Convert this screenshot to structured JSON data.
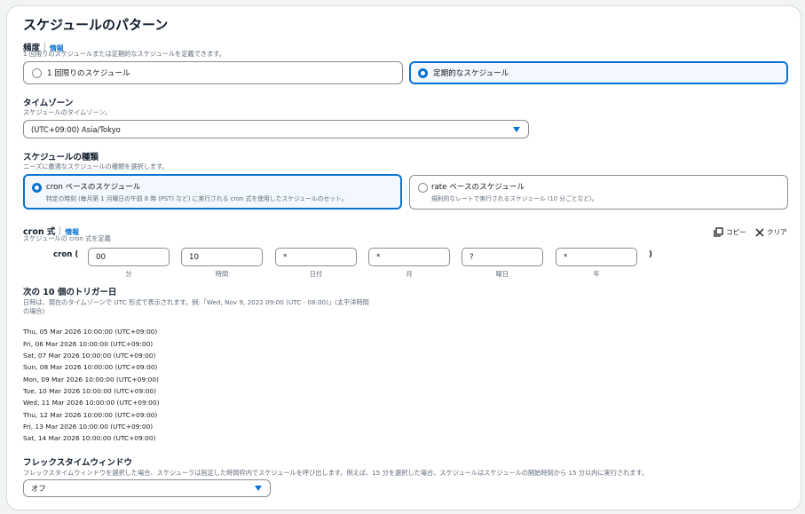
{
  "section": {
    "title": "スケジュールのパターン"
  },
  "frequency": {
    "label": "頻度",
    "info": "情報",
    "description": "1 回限りのスケジュールまたは定期的なスケジュールを定義できます。",
    "options": [
      {
        "label": "1 回限りのスケジュール",
        "selected": false
      },
      {
        "label": "定期的なスケジュール",
        "selected": true
      }
    ]
  },
  "timezone": {
    "label": "タイムゾーン",
    "description": "スケジュールのタイムゾーン。",
    "value": "(UTC+09:00) Asia/Tokyo"
  },
  "schedule_type": {
    "label": "スケジュールの種類",
    "description": "ニーズに最適なスケジュールの種類を選択します。",
    "options": [
      {
        "label": "cron ベースのスケジュール",
        "description": "特定の時刻 (毎月第 1 月曜日の午前 8 時 (PST) など) に実行される cron 式を使用したスケジュールのセット。",
        "selected": true
      },
      {
        "label": "rate ベースのスケジュール",
        "description": "規則的なレートで実行されるスケジュール (10 分ごとなど)。",
        "selected": false
      }
    ]
  },
  "cron": {
    "label": "cron 式",
    "info": "情報",
    "description": "スケジュールの cron 式を定義",
    "copy_label": "コピー",
    "clear_label": "クリア",
    "prefix": "cron (",
    "suffix": ")",
    "fields": [
      {
        "value": "00",
        "caption": "分"
      },
      {
        "value": "10",
        "caption": "時間"
      },
      {
        "value": "*",
        "caption": "日付"
      },
      {
        "value": "*",
        "caption": "月"
      },
      {
        "value": "?",
        "caption": "曜日"
      },
      {
        "value": "*",
        "caption": "年"
      }
    ]
  },
  "triggers": {
    "label": "次の 10 個のトリガー日",
    "description_line1": "日時は、現在のタイムゾーンで UTC 形式で表示されます。例:「Wed, Nov 9, 2022 09:00 (UTC - 08:00)」(太平洋時間",
    "description_line2": "の場合)",
    "dates": [
      "Thu, 05 Mar 2026 10:00:00 (UTC+09:00)",
      "Fri, 06 Mar 2026 10:00:00 (UTC+09:00)",
      "Sat, 07 Mar 2026 10:00:00 (UTC+09:00)",
      "Sun, 08 Mar 2026 10:00:00 (UTC+09:00)",
      "Mon, 09 Mar 2026 10:00:00 (UTC+09:00)",
      "Tue, 10 Mar 2026 10:00:00 (UTC+09:00)",
      "Wed, 11 Mar 2026 10:00:00 (UTC+09:00)",
      "Thu, 12 Mar 2026 10:00:00 (UTC+09:00)",
      "Fri, 13 Mar 2026 10:00:00 (UTC+09:00)",
      "Sat, 14 Mar 2026 10:00:00 (UTC+09:00)"
    ]
  },
  "flex_window": {
    "label": "フレックスタイムウィンドウ",
    "description": "フレックスタイムウィンドウを選択した場合、スケジューラは指定した時間枠内でスケジュールを呼び出します。例えば、15 分を選択した場合、スケジュールはスケジュールの開始時刻から 15 分以内に実行されます。",
    "value": "オフ"
  },
  "colors": {
    "accent": "#0972d3",
    "border": "#8c8c94",
    "muted": "#5f6b7a"
  }
}
